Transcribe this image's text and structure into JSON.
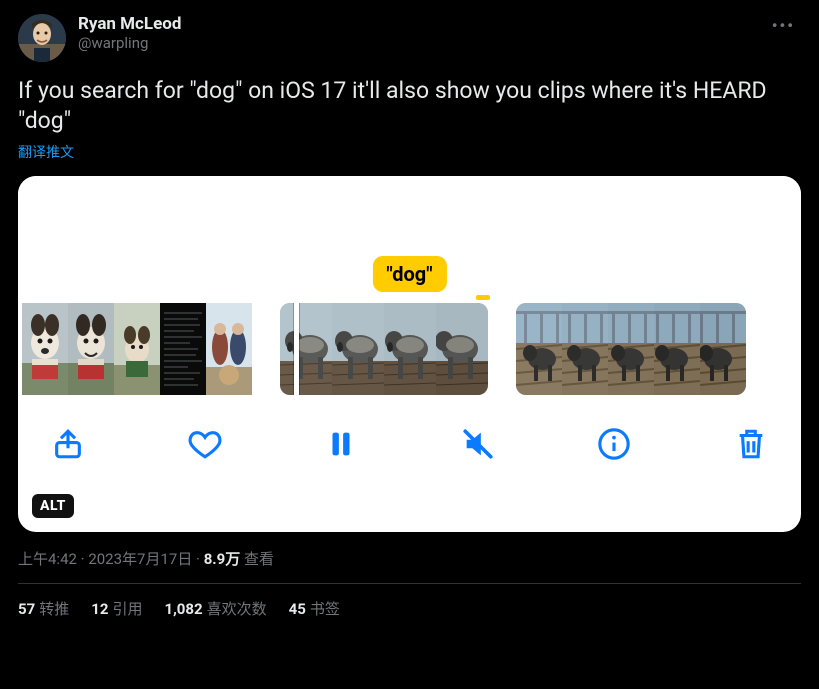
{
  "author": {
    "display_name": "Ryan McLeod",
    "handle": "@warpling"
  },
  "more_icon": "•••",
  "body": "If you search for \"dog\" on iOS 17 it'll also show you clips where it's HEARD \"dog\"",
  "translate_label": "翻译推文",
  "media": {
    "chip_label": "\"dog\"",
    "alt_badge": "ALT",
    "toolbar_icons": {
      "share": "share-icon",
      "like": "heart-icon",
      "pause": "pause-icon",
      "mute": "speaker-mute-icon",
      "info": "info-icon",
      "delete": "trash-icon"
    }
  },
  "meta": {
    "time": "上午4:42",
    "dot1": " · ",
    "date": "2023年7月17日",
    "dot2": " · ",
    "views_count": "8.9万",
    "views_label": " 查看"
  },
  "stats": {
    "retweets": {
      "count": "57",
      "label": "转推"
    },
    "quotes": {
      "count": "12",
      "label": "引用"
    },
    "likes": {
      "count": "1,082",
      "label": "喜欢次数"
    },
    "bookmarks": {
      "count": "45",
      "label": "书签"
    }
  }
}
